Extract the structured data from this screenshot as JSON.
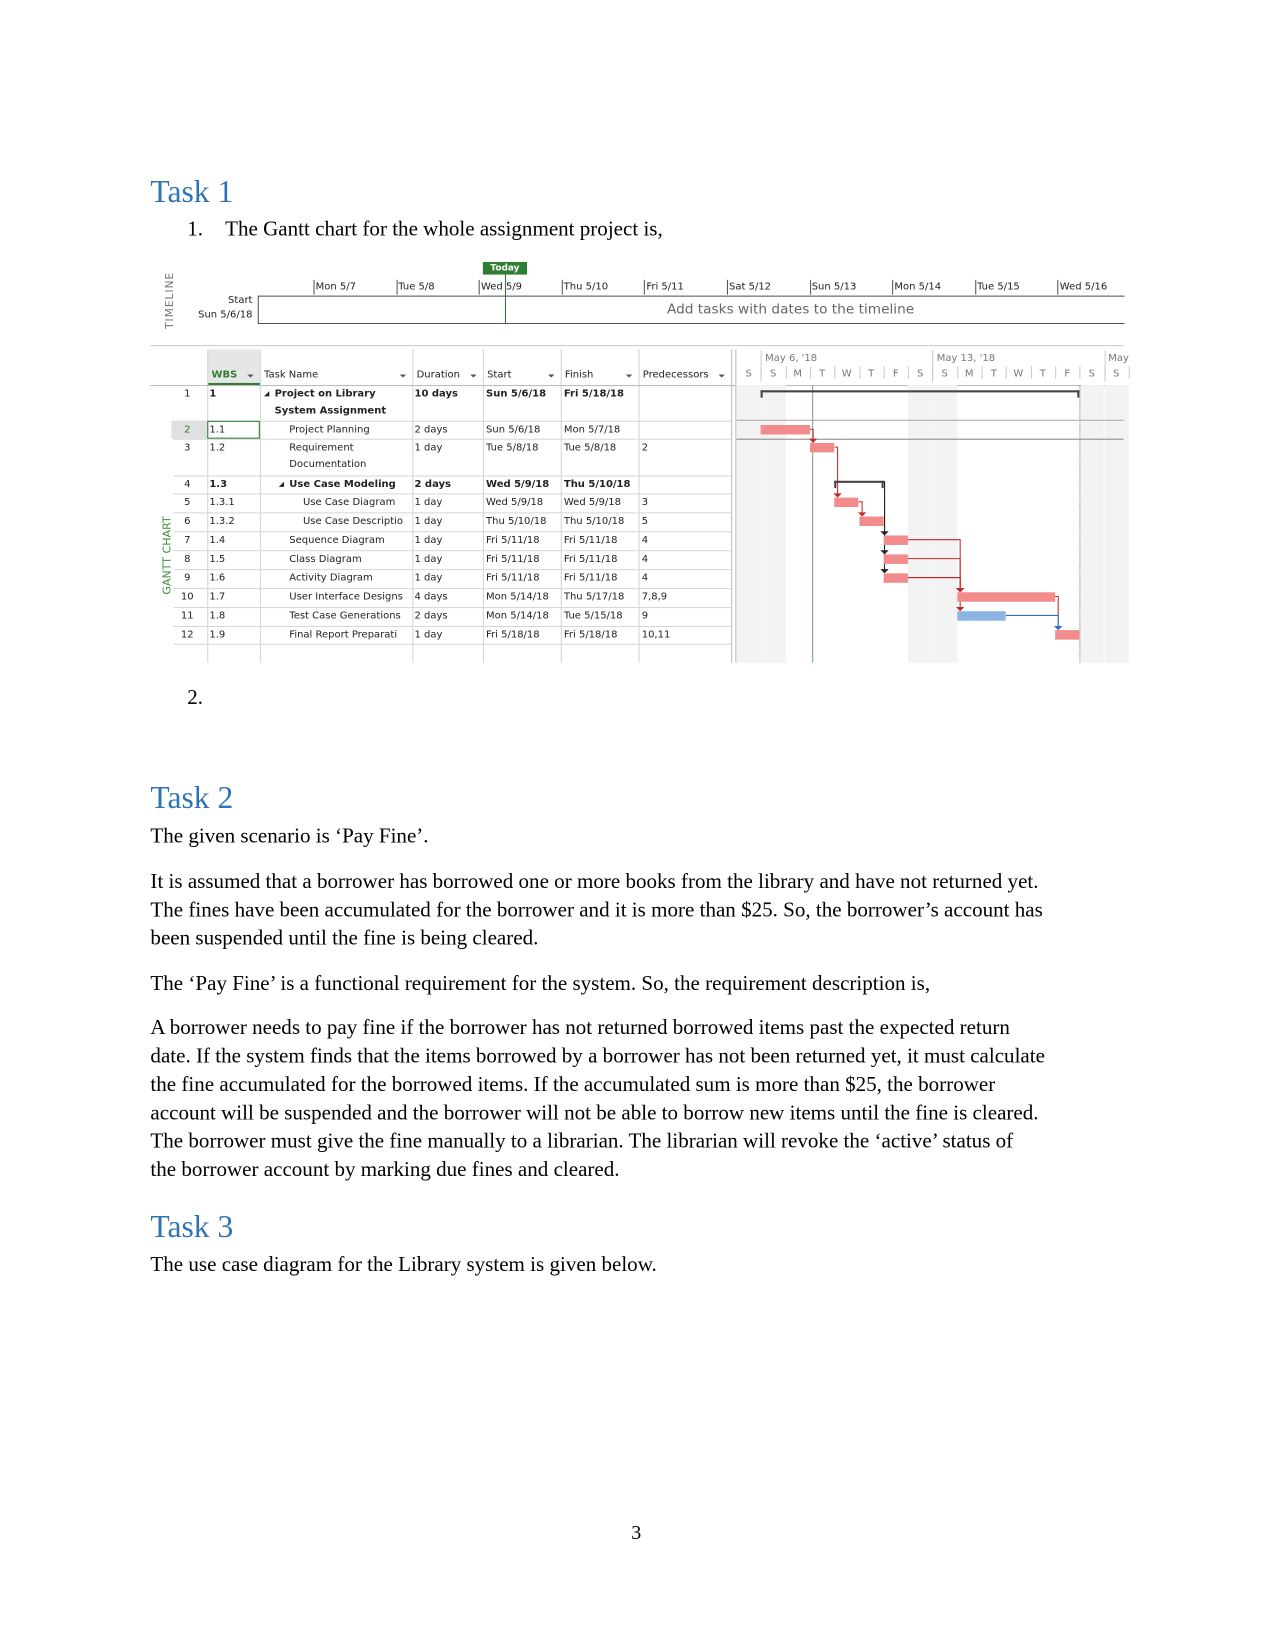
{
  "task1": {
    "heading": "Task 1",
    "item1_number": "1.",
    "item1_text": "The Gantt chart for the whole assignment project is,",
    "item2_number": "2."
  },
  "gantt": {
    "timeline_label": "TIMELINE",
    "gantt_label": "GANTT CHART",
    "today_label": "Today",
    "start_label": "Start",
    "start_date": "Sun 5/6/18",
    "placeholder": "Add tasks with dates to the timeline",
    "timeline_ticks": [
      "Mon 5/7",
      "Tue 5/8",
      "Wed 5/9",
      "Thu 5/10",
      "Fri 5/11",
      "Sat 5/12",
      "Sun 5/13",
      "Mon 5/14",
      "Tue 5/15",
      "Wed 5/16"
    ],
    "columns": [
      "WBS",
      "Task Name",
      "Duration",
      "Start",
      "Finish",
      "Predecessors"
    ],
    "week_labels": [
      "May 6, '18",
      "May 13, '18",
      "May"
    ],
    "day_letters": [
      "S",
      "S",
      "M",
      "T",
      "W",
      "T",
      "F",
      "S",
      "S",
      "M",
      "T",
      "W",
      "T",
      "F",
      "S",
      "S"
    ],
    "selected_row": 2,
    "colors": {
      "critical": "#f28b8b",
      "noncritical": "#8db3e2",
      "today": "#2e7d32",
      "heading": "#2e74b5"
    }
  },
  "chart_data": {
    "type": "table",
    "rows": [
      {
        "id": "1",
        "wbs": "1",
        "name": "Project on Library System Assignment",
        "name_lines": [
          "Project on Library",
          "System Assignment"
        ],
        "duration": "10 days",
        "start": "Sun 5/6/18",
        "finish": "Fri 5/18/18",
        "pred": "",
        "summary": true,
        "level": 1,
        "s": 1,
        "f": 13
      },
      {
        "id": "2",
        "wbs": "1.1",
        "name": "Project Planning",
        "duration": "2 days",
        "start": "Sun 5/6/18",
        "finish": "Mon 5/7/18",
        "pred": "",
        "level": 2,
        "s": 1,
        "f": 2
      },
      {
        "id": "3",
        "wbs": "1.2",
        "name": "Requirement Documentation",
        "name_lines": [
          "Requirement",
          "Documentation"
        ],
        "duration": "1 day",
        "start": "Tue 5/8/18",
        "finish": "Tue 5/8/18",
        "pred": "2",
        "level": 2,
        "s": 3,
        "f": 3
      },
      {
        "id": "4",
        "wbs": "1.3",
        "name": "Use Case Modeling",
        "duration": "2 days",
        "start": "Wed 5/9/18",
        "finish": "Thu 5/10/18",
        "pred": "",
        "summary": true,
        "level": 2,
        "s": 4,
        "f": 5
      },
      {
        "id": "5",
        "wbs": "1.3.1",
        "name": "Use Case Diagram",
        "duration": "1 day",
        "start": "Wed 5/9/18",
        "finish": "Wed 5/9/18",
        "pred": "3",
        "level": 3,
        "s": 4,
        "f": 4
      },
      {
        "id": "6",
        "wbs": "1.3.2",
        "name": "Use Case Descriptio",
        "duration": "1 day",
        "start": "Thu 5/10/18",
        "finish": "Thu 5/10/18",
        "pred": "5",
        "level": 3,
        "s": 5,
        "f": 5
      },
      {
        "id": "7",
        "wbs": "1.4",
        "name": "Sequence Diagram",
        "duration": "1 day",
        "start": "Fri 5/11/18",
        "finish": "Fri 5/11/18",
        "pred": "4",
        "level": 2,
        "s": 6,
        "f": 6
      },
      {
        "id": "8",
        "wbs": "1.5",
        "name": "Class Diagram",
        "duration": "1 day",
        "start": "Fri 5/11/18",
        "finish": "Fri 5/11/18",
        "pred": "4",
        "level": 2,
        "s": 6,
        "f": 6
      },
      {
        "id": "9",
        "wbs": "1.6",
        "name": "Activity Diagram",
        "duration": "1 day",
        "start": "Fri 5/11/18",
        "finish": "Fri 5/11/18",
        "pred": "4",
        "level": 2,
        "s": 6,
        "f": 6
      },
      {
        "id": "10",
        "wbs": "1.7",
        "name": "User Interface Designs",
        "duration": "4 days",
        "start": "Mon 5/14/18",
        "finish": "Thu 5/17/18",
        "pred": "7,8,9",
        "level": 2,
        "s": 9,
        "f": 12
      },
      {
        "id": "11",
        "wbs": "1.8",
        "name": "Test Case Generations",
        "duration": "2 days",
        "start": "Mon 5/14/18",
        "finish": "Tue 5/15/18",
        "pred": "9",
        "level": 2,
        "s": 9,
        "f": 10,
        "noncritical": true
      },
      {
        "id": "12",
        "wbs": "1.9",
        "name": "Final Report Preparati",
        "duration": "1 day",
        "start": "Fri 5/18/18",
        "finish": "Fri 5/18/18",
        "pred": "10,11",
        "level": 2,
        "s": 13,
        "f": 13
      }
    ]
  },
  "task2": {
    "heading": "Task 2",
    "lines": [
      "The given scenario is ‘Pay Fine’.",
      "It is assumed that a borrower has borrowed one or more books from the library and have not returned yet.",
      "The fines have been accumulated for the borrower and it is more than $25. So, the borrower’s account has",
      "been suspended until the fine is being cleared.",
      "The ‘Pay Fine’ is a functional requirement for the system. So, the requirement description is,",
      "A borrower needs to pay fine if the borrower has not returned borrowed items past the expected return",
      "date. If the system finds that the items borrowed by a borrower has not been returned yet, it must calculate",
      "the fine accumulated for the borrowed items. If the accumulated sum is more than $25, the borrower",
      "account will be suspended and the borrower will not be able to borrow new items until the fine is cleared.",
      "The borrower must give the fine manually to a librarian. The librarian will revoke the ‘active’ status of",
      "the borrower account by marking due fines and cleared."
    ]
  },
  "task3": {
    "heading": "Task 3",
    "text": "The use case diagram for the Library system is given below."
  },
  "page_number": "3"
}
